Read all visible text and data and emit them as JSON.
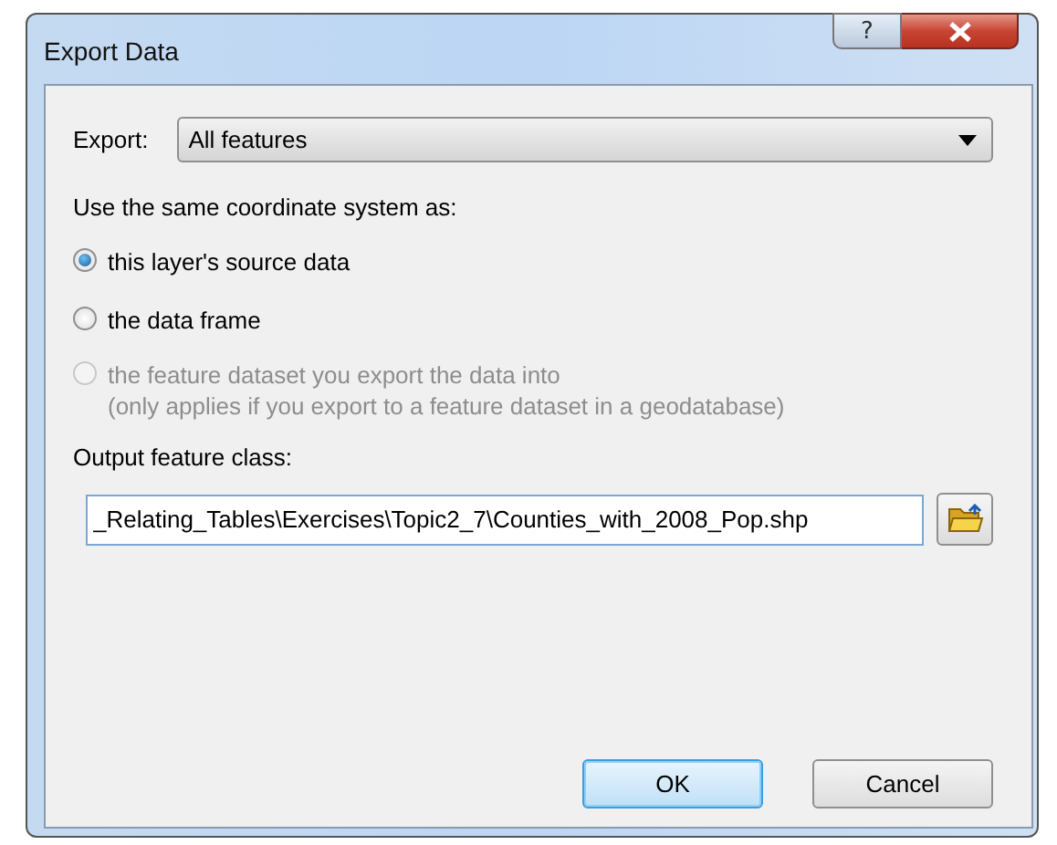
{
  "window": {
    "title": "Export Data",
    "help_button": "?"
  },
  "export": {
    "label": "Export:",
    "value": "All features"
  },
  "coordinate_system": {
    "label": "Use the same coordinate system as:",
    "options": [
      {
        "label": "this layer's source data",
        "selected": true,
        "disabled": false
      },
      {
        "label": "the data frame",
        "selected": false,
        "disabled": false
      },
      {
        "label": "the feature dataset you export the data into",
        "note": "(only applies if you export to a feature dataset in a geodatabase)",
        "selected": false,
        "disabled": true
      }
    ]
  },
  "output": {
    "label": "Output feature class:",
    "value": "_Relating_Tables\\Exercises\\Topic2_7\\Counties_with_2008_Pop.shp"
  },
  "buttons": [
    {
      "label": "OK",
      "default": true
    },
    {
      "label": "Cancel",
      "default": false
    }
  ]
}
